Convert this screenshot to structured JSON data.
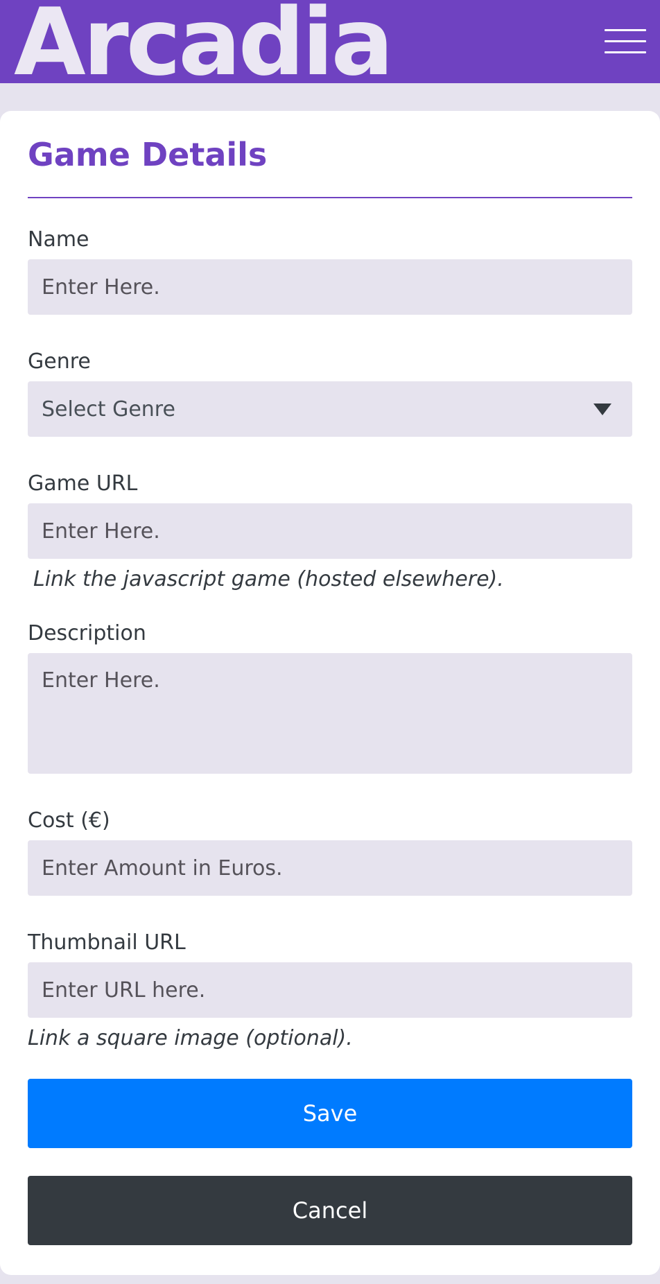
{
  "header": {
    "brand": "Arcadia",
    "menu_icon": "hamburger-menu-icon",
    "color": "#6f42c1"
  },
  "form": {
    "title": "Game Details",
    "name": {
      "label": "Name",
      "placeholder": "Enter Here."
    },
    "genre": {
      "label": "Genre",
      "selected": "Select Genre",
      "icon": "caret-down-icon"
    },
    "game_url": {
      "label": "Game URL",
      "placeholder": "Enter Here.",
      "hint": "Link the javascript game (hosted elsewhere)."
    },
    "description": {
      "label": "Description",
      "placeholder": "Enter Here."
    },
    "cost": {
      "label": "Cost (€)",
      "placeholder": "Enter Amount in Euros."
    },
    "thumbnail_url": {
      "label": "Thumbnail URL",
      "placeholder": "Enter URL here.",
      "hint": "Link a square image (optional)."
    },
    "save_label": "Save",
    "cancel_label": "Cancel"
  },
  "colors": {
    "accent": "#6f42c1",
    "primary": "#007bff",
    "dark": "#343a40",
    "field_bg": "#e6e3ee"
  }
}
